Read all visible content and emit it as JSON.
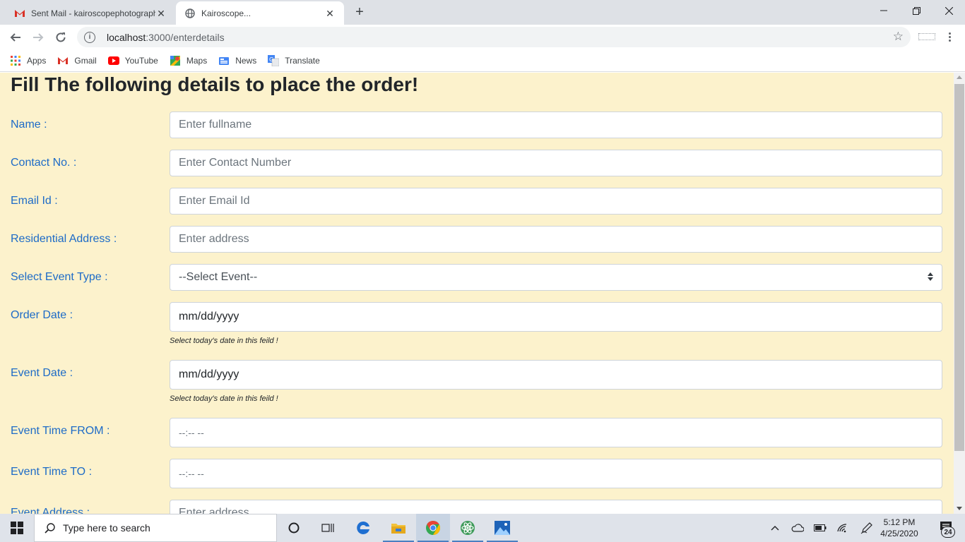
{
  "browser": {
    "tabs": [
      {
        "title": "Sent Mail - kairoscopephotography",
        "icon": "gmail-icon",
        "active": false
      },
      {
        "title": "Kairoscope...",
        "icon": "globe-icon",
        "active": true
      }
    ],
    "url_host": "localhost",
    "url_path": ":3000/enterdetails",
    "bookmarks": [
      {
        "label": "Apps",
        "icon": "apps-grid-icon"
      },
      {
        "label": "Gmail",
        "icon": "gmail-icon"
      },
      {
        "label": "YouTube",
        "icon": "youtube-icon"
      },
      {
        "label": "Maps",
        "icon": "maps-icon"
      },
      {
        "label": "News",
        "icon": "news-icon"
      },
      {
        "label": "Translate",
        "icon": "translate-icon"
      }
    ]
  },
  "page": {
    "heading": "Fill The following details to place the order!",
    "fields": {
      "name": {
        "label": "Name :",
        "placeholder": "Enter fullname"
      },
      "contact": {
        "label": "Contact No. :",
        "placeholder": "Enter Contact Number"
      },
      "email": {
        "label": "Email Id :",
        "placeholder": "Enter Email Id"
      },
      "address": {
        "label": "Residential Address :",
        "placeholder": "Enter address"
      },
      "event_type": {
        "label": "Select Event Type :",
        "value": "--Select Event--"
      },
      "order_date": {
        "label": "Order Date :",
        "value": "mm/dd/yyyy",
        "help": "Select today's date in this feild !"
      },
      "event_date": {
        "label": "Event Date :",
        "value": "mm/dd/yyyy",
        "help": "Select today's date in this feild !"
      },
      "time_from": {
        "label": "Event Time FROM :",
        "value": "--:-- --"
      },
      "time_to": {
        "label": "Event Time TO :",
        "value": "--:-- --"
      },
      "event_address": {
        "label": "Event Address :",
        "placeholder": "Enter address"
      }
    }
  },
  "taskbar": {
    "search_placeholder": "Type here to search",
    "time": "5:12 PM",
    "date": "4/25/2020",
    "notification_count": "24"
  },
  "colors": {
    "page_bg": "#fcf2cc",
    "label": "#1d6bc7",
    "heading": "#212529"
  }
}
